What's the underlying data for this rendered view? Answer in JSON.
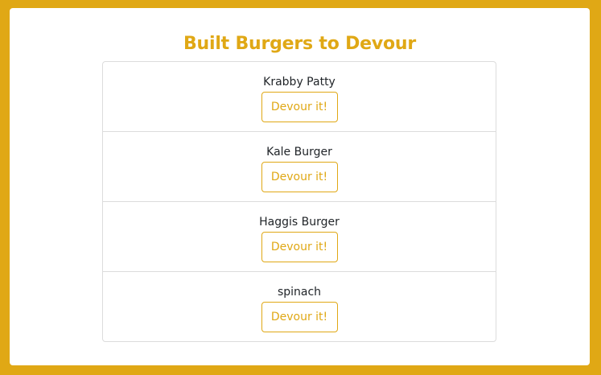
{
  "page": {
    "title": "Built Burgers to Devour"
  },
  "burgers": [
    {
      "name": "Krabby Patty",
      "button_label": "Devour it!"
    },
    {
      "name": "Kale Burger",
      "button_label": "Devour it!"
    },
    {
      "name": "Haggis Burger",
      "button_label": "Devour it!"
    },
    {
      "name": "spinach",
      "button_label": "Devour it!"
    }
  ],
  "colors": {
    "background": "#e0a815",
    "accent": "#e0a815",
    "card": "#ffffff",
    "text": "#212529",
    "border": "#dcdcdc"
  }
}
